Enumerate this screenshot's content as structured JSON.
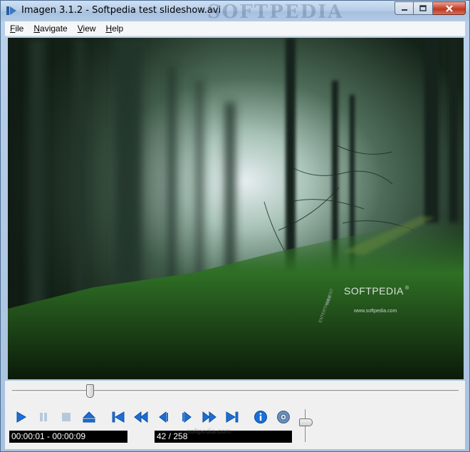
{
  "window": {
    "title": "Imagen 3.1.2 - Softpedia test slideshow.avi",
    "watermark": "SOFTPEDIA"
  },
  "menu": [
    {
      "label": "File",
      "accel": "F",
      "rest": "ile"
    },
    {
      "label": "Navigate",
      "accel": "N",
      "rest": "avigate"
    },
    {
      "label": "View",
      "accel": "V",
      "rest": "iew"
    },
    {
      "label": "Help",
      "accel": "H",
      "rest": "elp"
    }
  ],
  "viewer": {
    "brand_text": "SOFTPEDIA",
    "brand_mark": "®",
    "brand_url": "www.softpedia.com",
    "brand_side_a": "WEB",
    "brand_side_b": "ENTERTAINMENT"
  },
  "playback": {
    "seek_fraction": 0.175,
    "volume_fraction": 0.6,
    "time_display": "00:00:01 - 00:00:09",
    "frame_display": "42 / 258",
    "ghost_text": "softpedia.com"
  },
  "buttons": [
    {
      "name": "play-button",
      "icon": "play-icon"
    },
    {
      "name": "pause-button",
      "icon": "pause-icon"
    },
    {
      "name": "stop-button",
      "icon": "stop-icon"
    },
    {
      "name": "eject-button",
      "icon": "eject-icon"
    },
    {
      "name": "first-frame-button",
      "icon": "skip-to-start-icon"
    },
    {
      "name": "rewind-button",
      "icon": "rewind-icon"
    },
    {
      "name": "previous-frame-button",
      "icon": "step-back-icon"
    },
    {
      "name": "next-frame-button",
      "icon": "step-forward-icon"
    },
    {
      "name": "fast-forward-button",
      "icon": "fast-forward-icon"
    },
    {
      "name": "last-frame-button",
      "icon": "skip-to-end-icon"
    },
    {
      "name": "info-button",
      "icon": "info-icon"
    },
    {
      "name": "settings-button",
      "icon": "settings-icon"
    }
  ],
  "colors": {
    "button_blue": "#1a6fd6",
    "button_disabled": "#b8c8dc",
    "lcd_bg": "#000000",
    "lcd_text": "#ffffff"
  }
}
